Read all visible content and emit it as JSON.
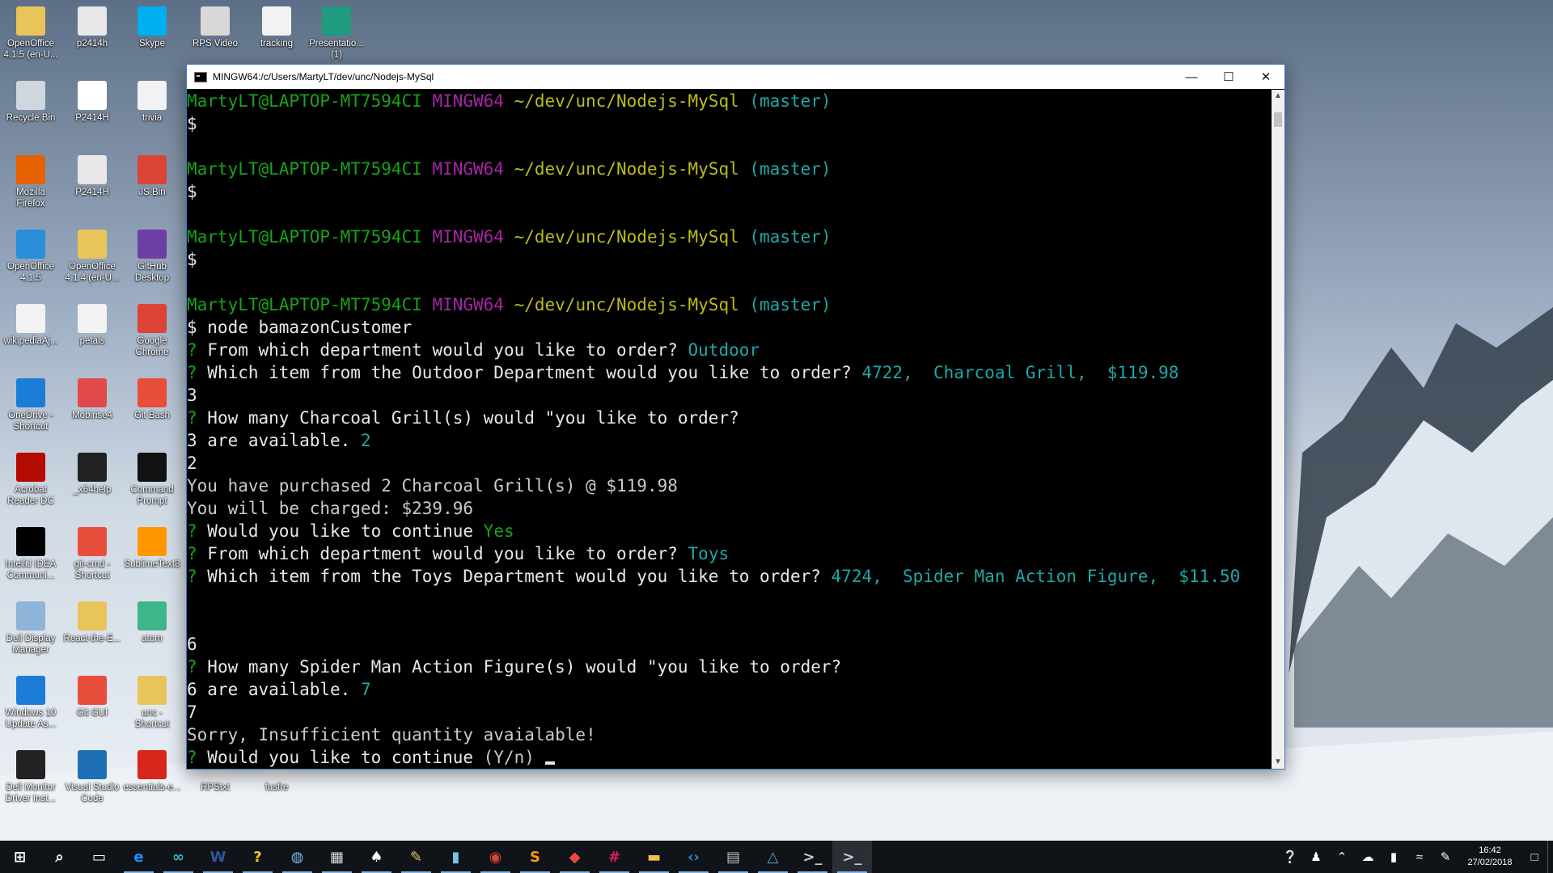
{
  "desktop_icons": [
    {
      "label": "OpenOffice\n4.1.5 (en-U...",
      "icon": "folder-icon",
      "color": "#e8c45a"
    },
    {
      "label": "p2414h",
      "icon": "document-icon",
      "color": "#e7e7e7"
    },
    {
      "label": "Skype",
      "icon": "skype-icon",
      "color": "#00aff0"
    },
    {
      "label": "RPS Video",
      "icon": "video-icon",
      "color": "#d8d8d8"
    },
    {
      "label": "tracking",
      "icon": "document-icon",
      "color": "#f2f2f2"
    },
    {
      "label": "Presentatio...\n(1)",
      "icon": "presentation-icon",
      "color": "#1f9b7f"
    },
    {
      "label": "Recycle Bin",
      "icon": "recycle-bin-icon",
      "color": "#cfd6de"
    },
    {
      "label": "P2414H",
      "icon": "triangle-app-icon",
      "color": "#ffffff"
    },
    {
      "label": "trivia",
      "icon": "document-icon",
      "color": "#f2f2f2"
    },
    {
      "label": "Mozilla\nFirefox",
      "icon": "firefox-icon",
      "color": "#e66000"
    },
    {
      "label": "P2414H",
      "icon": "document-icon",
      "color": "#e7e7e7"
    },
    {
      "label": "JS Bin",
      "icon": "chrome-icon",
      "color": "#db4437"
    },
    {
      "label": "OpenOffice\n4.1.5",
      "icon": "openoffice-icon",
      "color": "#2a8fd8"
    },
    {
      "label": "OpenOffice\n4.1.4 (en-U...",
      "icon": "folder-icon",
      "color": "#e8c45a"
    },
    {
      "label": "GitHub\nDesktop",
      "icon": "github-icon",
      "color": "#6e3fa3"
    },
    {
      "label": "wikipediaAj...",
      "icon": "document-icon",
      "color": "#f2f2f2"
    },
    {
      "label": "petals",
      "icon": "document-icon",
      "color": "#f2f2f2"
    },
    {
      "label": "Google\nChrome",
      "icon": "chrome-icon",
      "color": "#db4437"
    },
    {
      "label": "OneDrive -\nShortcut",
      "icon": "onedrive-icon",
      "color": "#1c7dd8"
    },
    {
      "label": "Mobirise4",
      "icon": "mobirise-icon",
      "color": "#e04a4a"
    },
    {
      "label": "Git Bash",
      "icon": "git-icon",
      "color": "#e84e3c"
    },
    {
      "label": "Acrobat\nReader DC",
      "icon": "acrobat-icon",
      "color": "#b30b00"
    },
    {
      "label": "_x64help",
      "icon": "gear-icon",
      "color": "#222222"
    },
    {
      "label": "Command\nPrompt",
      "icon": "terminal-icon",
      "color": "#111111"
    },
    {
      "label": "IntelliJ IDEA\nCommuni...",
      "icon": "intellij-icon",
      "color": "#000000"
    },
    {
      "label": "git-cmd -\nShortcut",
      "icon": "git-icon",
      "color": "#e84e3c"
    },
    {
      "label": "SublimeText3",
      "icon": "sublime-icon",
      "color": "#ff9800"
    },
    {
      "label": "Dell Display\nManager",
      "icon": "monitor-icon",
      "color": "#8fb4d9"
    },
    {
      "label": "React-the-E...",
      "icon": "react-icon",
      "color": "#e8c45a"
    },
    {
      "label": "atom",
      "icon": "atom-icon",
      "color": "#3fb58a"
    },
    {
      "label": "Windows 10\nUpdate As...",
      "icon": "windows-icon",
      "color": "#1c7dd8"
    },
    {
      "label": "Git GUI",
      "icon": "git-icon",
      "color": "#e84e3c"
    },
    {
      "label": "unc -\nShortcut",
      "icon": "folder-icon",
      "color": "#e8c45a"
    },
    {
      "label": "Dell Monitor\nDriver Inst...",
      "icon": "gear-icon",
      "color": "#222222"
    },
    {
      "label": "Visual Studio\nCode",
      "icon": "vscode-icon",
      "color": "#1f6fb5"
    },
    {
      "label": "essentials-e...",
      "icon": "pdf-icon",
      "color": "#d8261c"
    },
    {
      "label": "RPStxt",
      "icon": "document-icon",
      "color": "#f2f2f2"
    },
    {
      "label": "fusfre",
      "icon": "document-icon",
      "color": "#f2f2f2"
    }
  ],
  "window": {
    "title": "MINGW64:/c/Users/MartyLT/dev/unc/Nodejs-MySql",
    "minimize": "—",
    "maximize": "☐",
    "close": "✕"
  },
  "terminal": {
    "lines": [
      [
        [
          "MartyLT@LAPTOP-MT7594CI ",
          "green"
        ],
        [
          "MINGW64 ",
          "mag"
        ],
        [
          "~/dev/unc/Nodejs-MySql",
          "yel"
        ],
        [
          " (master)",
          "cyan"
        ]
      ],
      [
        [
          "$",
          "white"
        ]
      ],
      [],
      [
        [
          "MartyLT@LAPTOP-MT7594CI ",
          "green"
        ],
        [
          "MINGW64 ",
          "mag"
        ],
        [
          "~/dev/unc/Nodejs-MySql",
          "yel"
        ],
        [
          " (master)",
          "cyan"
        ]
      ],
      [
        [
          "$",
          "white"
        ]
      ],
      [],
      [
        [
          "MartyLT@LAPTOP-MT7594CI ",
          "green"
        ],
        [
          "MINGW64 ",
          "mag"
        ],
        [
          "~/dev/unc/Nodejs-MySql",
          "yel"
        ],
        [
          " (master)",
          "cyan"
        ]
      ],
      [
        [
          "$",
          "white"
        ]
      ],
      [],
      [
        [
          "MartyLT@LAPTOP-MT7594CI ",
          "green"
        ],
        [
          "MINGW64 ",
          "mag"
        ],
        [
          "~/dev/unc/Nodejs-MySql",
          "yel"
        ],
        [
          " (master)",
          "cyan"
        ]
      ],
      [
        [
          "$ node bamazonCustomer",
          "white"
        ]
      ],
      [
        [
          "? ",
          "q"
        ],
        [
          "From which department would you like to order? ",
          "white"
        ],
        [
          "Outdoor",
          "cyan"
        ]
      ],
      [
        [
          "? ",
          "q"
        ],
        [
          "Which item from the Outdoor Department would you like to order? ",
          "white"
        ],
        [
          "4722,  Charcoal Grill,  $119.98",
          "cyan"
        ]
      ],
      [
        [
          "3",
          "white"
        ]
      ],
      [
        [
          "? ",
          "q"
        ],
        [
          "How many Charcoal Grill(s) would \"you like to order?",
          "white"
        ]
      ],
      [
        [
          "3 are available. ",
          "white"
        ],
        [
          "2",
          "cyan"
        ]
      ],
      [
        [
          "2",
          "white"
        ]
      ],
      [
        [
          "You have purchased 2 Charcoal Grill(s) @ $119.98",
          "plain"
        ]
      ],
      [
        [
          "You will be charged: $239.96",
          "plain"
        ]
      ],
      [
        [
          "? ",
          "q"
        ],
        [
          "Would you like to continue ",
          "white"
        ],
        [
          "Yes",
          "green"
        ]
      ],
      [
        [
          "? ",
          "q"
        ],
        [
          "From which department would you like to order? ",
          "white"
        ],
        [
          "Toys",
          "cyan"
        ]
      ],
      [
        [
          "? ",
          "q"
        ],
        [
          "Which item from the Toys Department would you like to order? ",
          "white"
        ],
        [
          "4724,  Spider Man Action Figure,  $11.50",
          "cyan"
        ]
      ],
      [],
      [],
      [
        [
          "6",
          "white"
        ]
      ],
      [
        [
          "? ",
          "q"
        ],
        [
          "How many Spider Man Action Figure(s) would \"you like to order?",
          "white"
        ]
      ],
      [
        [
          "6 are available. ",
          "white"
        ],
        [
          "7",
          "cyan"
        ]
      ],
      [
        [
          "7",
          "white"
        ]
      ],
      [
        [
          "Sorry, Insufficient quantity avaialable!",
          "plain"
        ]
      ],
      [
        [
          "? ",
          "q"
        ],
        [
          "Would you like to continue ",
          "white"
        ],
        [
          "(Y/n) ",
          "plain"
        ]
      ]
    ]
  },
  "taskbar": {
    "items": [
      {
        "name": "start-button",
        "icon": "windows-icon",
        "glyph": "⊞",
        "color": "#ffffff"
      },
      {
        "name": "search-button",
        "icon": "search-icon",
        "glyph": "⌕",
        "color": "#ffffff"
      },
      {
        "name": "task-view-button",
        "icon": "task-view-icon",
        "glyph": "▭",
        "color": "#ffffff"
      },
      {
        "name": "edge-button",
        "icon": "edge-icon",
        "glyph": "e",
        "color": "#1e90ff"
      },
      {
        "name": "infinity-app-button",
        "icon": "infinity-icon",
        "glyph": "∞",
        "color": "#3bb3c3"
      },
      {
        "name": "word-button",
        "icon": "word-icon",
        "glyph": "W",
        "color": "#2b579a"
      },
      {
        "name": "help-app-button",
        "icon": "question-icon",
        "glyph": "?",
        "color": "#f2c811"
      },
      {
        "name": "globe-app-button",
        "icon": "globe-icon",
        "glyph": "◍",
        "color": "#7ab8e8"
      },
      {
        "name": "calculator-button",
        "icon": "calculator-icon",
        "glyph": "▦",
        "color": "#dddddd"
      },
      {
        "name": "cards-app-button",
        "icon": "cards-icon",
        "glyph": "♠",
        "color": "#ffffff"
      },
      {
        "name": "ink-app-button",
        "icon": "ink-icon",
        "glyph": "✎",
        "color": "#e6c06a"
      },
      {
        "name": "notes-app-button",
        "icon": "notes-icon",
        "glyph": "▮",
        "color": "#7ac4e0"
      },
      {
        "name": "chrome-button",
        "icon": "chrome-icon",
        "glyph": "◉",
        "color": "#db4437"
      },
      {
        "name": "sublime-button",
        "icon": "sublime-icon",
        "glyph": "S",
        "color": "#ff9800"
      },
      {
        "name": "git-button",
        "icon": "git-icon",
        "glyph": "◆",
        "color": "#e84e3c"
      },
      {
        "name": "slack-button",
        "icon": "slack-icon",
        "glyph": "#",
        "color": "#e01e5a"
      },
      {
        "name": "file-explorer-button",
        "icon": "folder-icon",
        "glyph": "▬",
        "color": "#f2c04a"
      },
      {
        "name": "vscode-button",
        "icon": "vscode-icon",
        "glyph": "‹›",
        "color": "#2c8ee0"
      },
      {
        "name": "mysql-button",
        "icon": "database-icon",
        "glyph": "▤",
        "color": "#bfbfbf"
      },
      {
        "name": "workbench-button",
        "icon": "workbench-icon",
        "glyph": "△",
        "color": "#5fa0d0"
      },
      {
        "name": "cmd-button",
        "icon": "terminal-icon",
        "glyph": ">_",
        "color": "#cccccc"
      },
      {
        "name": "git-bash-button",
        "icon": "terminal-icon",
        "glyph": ">_",
        "color": "#cccccc"
      }
    ],
    "tray": {
      "clock_time": "16:42",
      "clock_date": "27/02/2018"
    }
  }
}
